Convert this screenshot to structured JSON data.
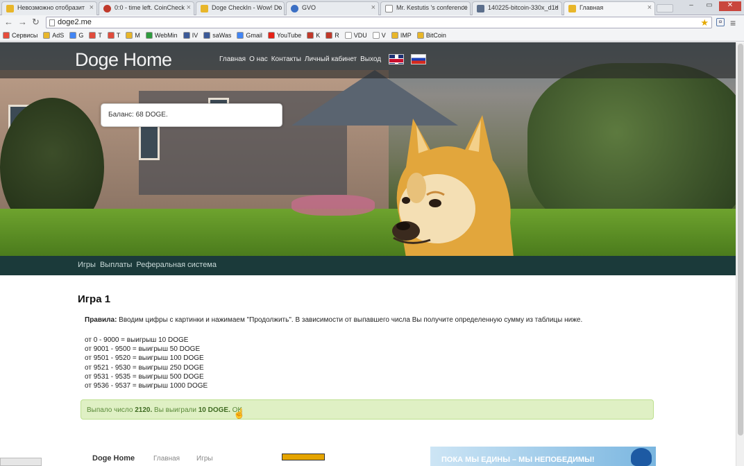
{
  "browser": {
    "tabs": [
      {
        "label": "Невозможно отобразит",
        "color": "#e8b62a"
      },
      {
        "label": "0:0 - time left. CoinCheck",
        "color": "#c0392b"
      },
      {
        "label": "Doge CheckIn - Wow! Do",
        "color": "#e8b62a"
      },
      {
        "label": "GVO",
        "color": "#3b6fc4"
      },
      {
        "label": "Mr. Kestutis 's conference",
        "color": "#ffffff"
      },
      {
        "label": "140225-bitcoin-330x_d1d",
        "color": "#5c6f8c"
      },
      {
        "label": "Главная",
        "color": "#e8b62a",
        "active": true
      }
    ],
    "address": "doge2.me",
    "bookmarks": [
      {
        "label": "Сервисы",
        "color": "#e74c3c"
      },
      {
        "label": "AdS",
        "color": "#e8b62a"
      },
      {
        "label": "G",
        "color": "#4285f4"
      },
      {
        "label": "T",
        "color": "#e04b3c"
      },
      {
        "label": "T",
        "color": "#e04b3c"
      },
      {
        "label": "M",
        "color": "#e8b62a"
      },
      {
        "label": "WebMin",
        "color": "#2e9b3e"
      },
      {
        "label": "IV",
        "color": "#3b5998"
      },
      {
        "label": "saWas",
        "color": "#3b5998"
      },
      {
        "label": "Gmail",
        "color": "#4285f4"
      },
      {
        "label": "YouTube",
        "color": "#e62117"
      },
      {
        "label": "K",
        "color": "#c0392b"
      },
      {
        "label": "R",
        "color": "#c0392b"
      },
      {
        "label": "VDU",
        "color": "#ffffff"
      },
      {
        "label": "V",
        "color": "#ffffff"
      },
      {
        "label": "IMP",
        "color": "#e8b62a"
      },
      {
        "label": "BitCoin",
        "color": "#e8b62a"
      }
    ]
  },
  "site": {
    "logo": "Doge Home",
    "nav": [
      "Главная",
      "О нас",
      "Контакты",
      "Личный кабинет",
      "Выход"
    ],
    "balance": "Баланс: 68 DOGE.",
    "subnav": [
      "Игры",
      "Выплаты",
      "Реферальная система"
    ]
  },
  "game": {
    "title": "Игра 1",
    "rules_label": "Правила:",
    "rules_text": " Вводим цифры с картинки и нажимаем \"Продолжить\". В зависимости от выпавшего числа Вы получите определенную сумму из таблицы ниже.",
    "prizes": [
      "от 0 - 9000 = выигрыш 10 DOGE",
      "от 9001 - 9500 = выигрыш 50 DOGE",
      "от 9501 - 9520 = выигрыш 100 DOGE",
      "от 9521 - 9530 = выигрыш 250 DOGE",
      "от 9531 - 9535 = выигрыш 500 DOGE",
      "от 9536 - 9537 = выигрыш 1000 DOGE"
    ],
    "result_prefix": "Выпало число ",
    "result_number": "2120.",
    "result_middle": " Вы выиграли ",
    "result_amount": "10 DOGE.",
    "result_ok": " OK"
  },
  "footer": {
    "brand": "Doge Home",
    "links": [
      "Главная",
      "Игры"
    ],
    "ad_text": "ПОКА МЫ ЕДИНЫ – МЫ НЕПОБЕДИМЫ!"
  }
}
